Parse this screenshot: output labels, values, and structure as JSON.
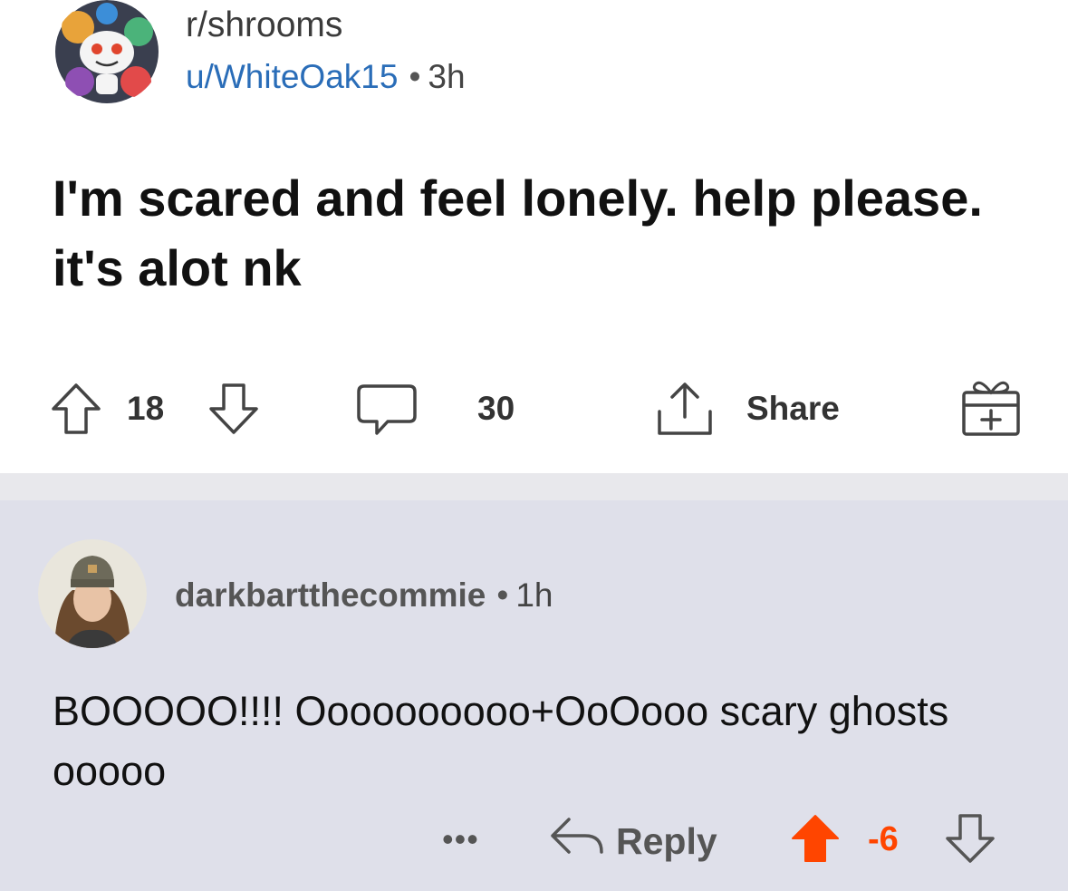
{
  "post": {
    "subreddit": "r/shrooms",
    "author": "u/WhiteOak15",
    "separator": "•",
    "age": "3h",
    "title": "I'm scared and feel lonely. help please. it's alot nk",
    "score": "18",
    "comments": "30",
    "share_label": "Share"
  },
  "comment": {
    "author": "darkbartthecommie",
    "separator": "•",
    "age": "1h",
    "body": "BOOOOO!!!! Oooooooooo+OoOooo scary ghosts ooooo",
    "more": "•••",
    "reply_label": "Reply",
    "score": "-6"
  },
  "icons": {
    "upvote": "arrow-up-icon",
    "downvote": "arrow-down-icon",
    "comment": "speech-bubble-icon",
    "share": "share-upload-icon",
    "award": "gift-award-icon",
    "reply": "reply-arrow-icon"
  },
  "colors": {
    "author_link": "#2a6db8",
    "upvoted": "#ff4500",
    "comment_background": "#dfe0ea"
  }
}
